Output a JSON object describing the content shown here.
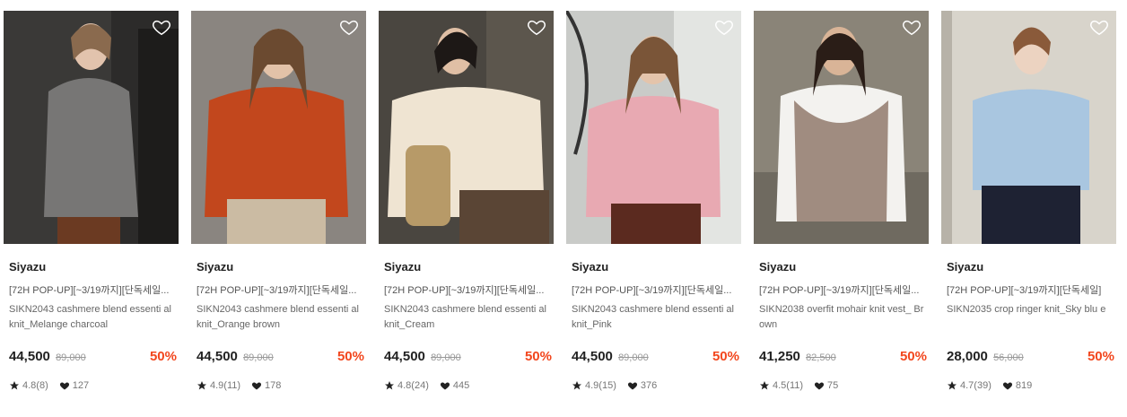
{
  "colors": {
    "discount": "#f2461d",
    "icon_dark": "#222222"
  },
  "icons": {
    "wishlist": "heart-outline-icon",
    "rating": "star-icon",
    "likes": "heart-icon"
  },
  "products": [
    {
      "brand": "Siyazu",
      "title": "[72H POP-UP][~3/19까지][단독세일...",
      "desc": "SIKN2043 cashmere blend essenti al knit_Melange charcoal",
      "price": "44,500",
      "original_price": "89,000",
      "discount": "50%",
      "rating": "4.8(8)",
      "likes": "127"
    },
    {
      "brand": "Siyazu",
      "title": "[72H POP-UP][~3/19까지][단독세일...",
      "desc": "SIKN2043 cashmere blend essenti al knit_Orange brown",
      "price": "44,500",
      "original_price": "89,000",
      "discount": "50%",
      "rating": "4.9(11)",
      "likes": "178"
    },
    {
      "brand": "Siyazu",
      "title": "[72H POP-UP][~3/19까지][단독세일...",
      "desc": "SIKN2043 cashmere blend essenti al knit_Cream",
      "price": "44,500",
      "original_price": "89,000",
      "discount": "50%",
      "rating": "4.8(24)",
      "likes": "445"
    },
    {
      "brand": "Siyazu",
      "title": "[72H POP-UP][~3/19까지][단독세일...",
      "desc": "SIKN2043 cashmere blend essenti al knit_Pink",
      "price": "44,500",
      "original_price": "89,000",
      "discount": "50%",
      "rating": "4.9(15)",
      "likes": "376"
    },
    {
      "brand": "Siyazu",
      "title": "[72H POP-UP][~3/19까지][단독세일...",
      "desc": "SIKN2038 overfit mohair knit vest_ Brown",
      "price": "41,250",
      "original_price": "82,500",
      "discount": "50%",
      "rating": "4.5(11)",
      "likes": "75"
    },
    {
      "brand": "Siyazu",
      "title": "[72H POP-UP][~3/19까지][단독세일]",
      "desc": "SIKN2035 crop ringer knit_Sky blu e",
      "price": "28,000",
      "original_price": "56,000",
      "discount": "50%",
      "rating": "4.7(39)",
      "likes": "819"
    }
  ]
}
